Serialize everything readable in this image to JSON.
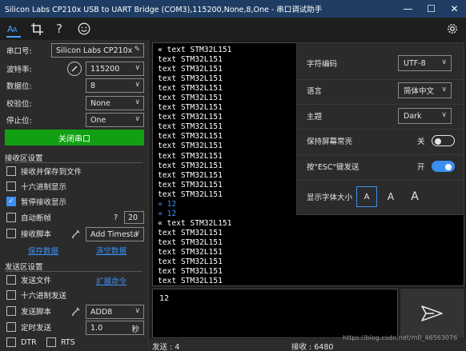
{
  "window": {
    "title": "Silicon Labs CP210x USB to UART Bridge (COM3),115200,None,8,One - 串口调试助手",
    "minimize": "—",
    "maximize": "☐",
    "close": "✕"
  },
  "toolbar": {
    "tools": [
      {
        "name": "font-tool-icon",
        "glyph": "AA",
        "active": true
      },
      {
        "name": "crop-tool-icon",
        "glyph": "⌗",
        "active": false
      },
      {
        "name": "help-icon",
        "glyph": "?",
        "active": false
      },
      {
        "name": "smiley-icon",
        "glyph": "☺",
        "active": false
      }
    ],
    "settings_glyph": "⚙"
  },
  "serial": {
    "port_label": "串口号:",
    "port_value": "Silicon Labs CP210x USB",
    "baud_label": "波特率:",
    "baud_value": "115200",
    "databits_label": "数据位:",
    "databits_value": "8",
    "parity_label": "校验位:",
    "parity_value": "None",
    "stopbits_label": "停止位:",
    "stopbits_value": "One",
    "close_button": "关闭串口"
  },
  "receive_settings": {
    "title": "接收区设置",
    "save_to_file": "接收并保存到文件",
    "hex_display": "十六进制显示",
    "pause_display": "暂停接收显示",
    "auto_frame": "自动断帧",
    "auto_frame_help": "?",
    "auto_frame_value": "20",
    "receive_script": "接收脚本",
    "timestamp_value": "Add Timesta",
    "save_data": "保存数据",
    "clear_data": "清空数据"
  },
  "send_settings": {
    "title": "发送区设置",
    "send_file": "发送文件",
    "extend_command": "扩展命令",
    "hex_send": "十六进制发送",
    "send_script": "发送脚本",
    "script_value": "ADD8",
    "timed_send": "定时发送",
    "timed_value": "1.0",
    "timed_unit": "秒",
    "dtr": "DTR",
    "rts": "RTS"
  },
  "receive_lines": [
    {
      "text": "« text STM32L151",
      "blue": false
    },
    {
      "text": "text STM32L151",
      "blue": false
    },
    {
      "text": "text STM32L151",
      "blue": false
    },
    {
      "text": "text STM32L151",
      "blue": false
    },
    {
      "text": "text STM32L151",
      "blue": false
    },
    {
      "text": "text STM32L151",
      "blue": false
    },
    {
      "text": "text STM32L151",
      "blue": false
    },
    {
      "text": "text STM32L151",
      "blue": false
    },
    {
      "text": "text STM32L151",
      "blue": false
    },
    {
      "text": "text STM32L151",
      "blue": false
    },
    {
      "text": "text STM32L151",
      "blue": false
    },
    {
      "text": "text STM32L151",
      "blue": false
    },
    {
      "text": "text STM32L151",
      "blue": false
    },
    {
      "text": "text STM32L151",
      "blue": false
    },
    {
      "text": "text STM32L151",
      "blue": false
    },
    {
      "text": "text STM32L151",
      "blue": false
    },
    {
      "text": "» 12",
      "blue": true
    },
    {
      "text": "» 12",
      "blue": true
    },
    {
      "text": "« text STM32L151",
      "blue": false
    },
    {
      "text": "text STM32L151",
      "blue": false
    },
    {
      "text": "text STM32L151",
      "blue": false
    },
    {
      "text": "text STM32L151",
      "blue": false
    },
    {
      "text": "text STM32L151",
      "blue": false
    },
    {
      "text": "text STM32L151",
      "blue": false
    },
    {
      "text": "text STM32L151",
      "blue": false
    }
  ],
  "settings_panel": {
    "encoding_label": "字符编码",
    "encoding_value": "UTF-8",
    "language_label": "语言",
    "language_value": "简体中文",
    "theme_label": "主题",
    "theme_value": "Dark",
    "keep_screen_label": "保持屏幕常亮",
    "keep_screen_state": "关",
    "esc_send_label": "按\"ESC\"键发送",
    "esc_send_state": "开",
    "font_size_label": "显示字体大小",
    "font_sizes": [
      "A",
      "A",
      "A"
    ]
  },
  "send_area": {
    "text": "12"
  },
  "status": {
    "sent": "发送 : 4",
    "received": "接收 : 6480"
  },
  "watermark": "https://blog.csdn.net/m0_46563076",
  "colors": {
    "accent": "#3b8ff0",
    "close_button": "#12a012",
    "titlebar": "#1f3d63"
  }
}
